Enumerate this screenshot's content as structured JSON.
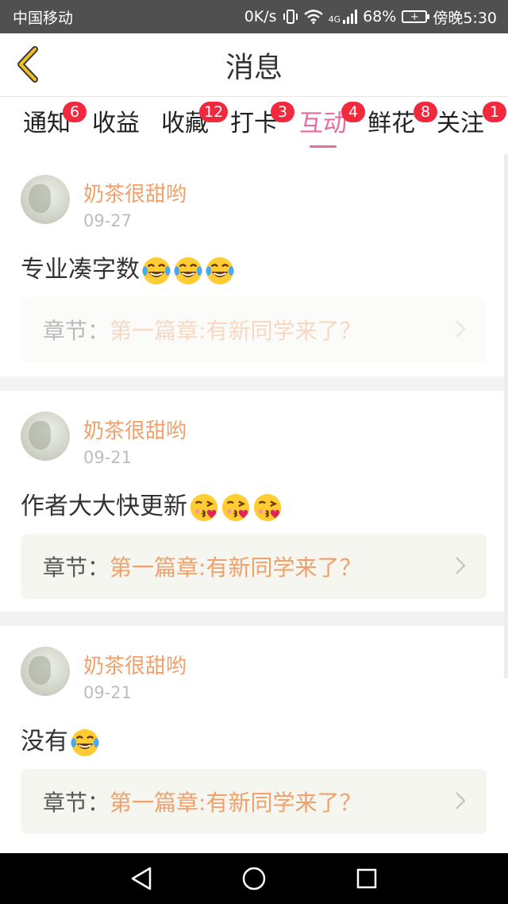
{
  "status_bar": {
    "carrier": "中国移动",
    "speed": "0K/s",
    "network": "4G",
    "battery": "68%",
    "time": "傍晚5:30"
  },
  "header": {
    "title": "消息",
    "back_icon": "chevron-left-icon",
    "accent_color": "#f0c020"
  },
  "tabs": [
    {
      "label": "通知",
      "badge": "6"
    },
    {
      "label": "收益",
      "badge": ""
    },
    {
      "label": "收藏",
      "badge": "12"
    },
    {
      "label": "打卡",
      "badge": "3"
    },
    {
      "label": "互动",
      "badge": "4",
      "active": true
    },
    {
      "label": "鲜花",
      "badge": "8"
    },
    {
      "label": "关注",
      "badge": "1"
    }
  ],
  "colors": {
    "active_tab": "#e86aa0",
    "badge": "#f02a3c",
    "username": "#f0a06a",
    "chapter_title": "#f0a06a"
  },
  "messages": [
    {
      "username": "奶茶很甜哟",
      "date": "09-27",
      "text": "专业凑字数",
      "emojis": [
        "laughing-tears-emoji",
        "laughing-tears-emoji",
        "laughing-tears-emoji"
      ],
      "chapter_prefix": "章节：",
      "chapter_title": "第一篇章:有新同学来了？"
    },
    {
      "username": "奶茶很甜哟",
      "date": "09-21",
      "text": "作者大大快更新",
      "emojis": [
        "kissing-heart-emoji",
        "kissing-heart-emoji",
        "kissing-heart-emoji"
      ],
      "chapter_prefix": "章节：",
      "chapter_title": "第一篇章:有新同学来了？"
    },
    {
      "username": "奶茶很甜哟",
      "date": "09-21",
      "text": "没有",
      "emojis": [
        "laughing-tears-emoji"
      ],
      "chapter_prefix": "章节：",
      "chapter_title": "第一篇章:有新同学来了？"
    }
  ],
  "nav_bar": {
    "back": "triangle-back-icon",
    "home": "circle-home-icon",
    "recents": "square-recents-icon"
  }
}
